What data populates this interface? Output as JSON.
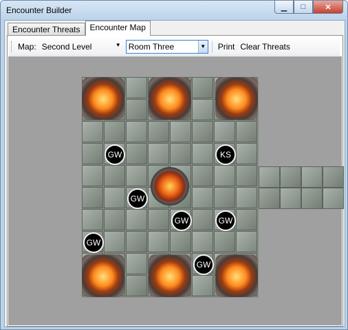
{
  "window": {
    "title": "Encounter Builder",
    "minimize_icon": "minimize-icon",
    "maximize_icon": "maximize-icon",
    "close_icon": "close-icon"
  },
  "tabs": [
    {
      "label": "Encounter Threats",
      "active": false
    },
    {
      "label": "Encounter Map",
      "active": true
    }
  ],
  "toolbar": {
    "map_label": "Map:",
    "map_select": {
      "value": "Second Level"
    },
    "room_select": {
      "value": "Room Three"
    },
    "print_label": "Print",
    "clear_label": "Clear Threats"
  },
  "map": {
    "tokens": [
      {
        "label": "GW"
      },
      {
        "label": "KS"
      },
      {
        "label": "GW"
      },
      {
        "label": "GW"
      },
      {
        "label": "GW"
      },
      {
        "label": "GW"
      },
      {
        "label": "GW"
      }
    ]
  },
  "colors": {
    "canvas": "#a0a0a0",
    "token_bg": "#000000",
    "token_border": "#f2f2f2",
    "fire": "#ff8a1e"
  }
}
